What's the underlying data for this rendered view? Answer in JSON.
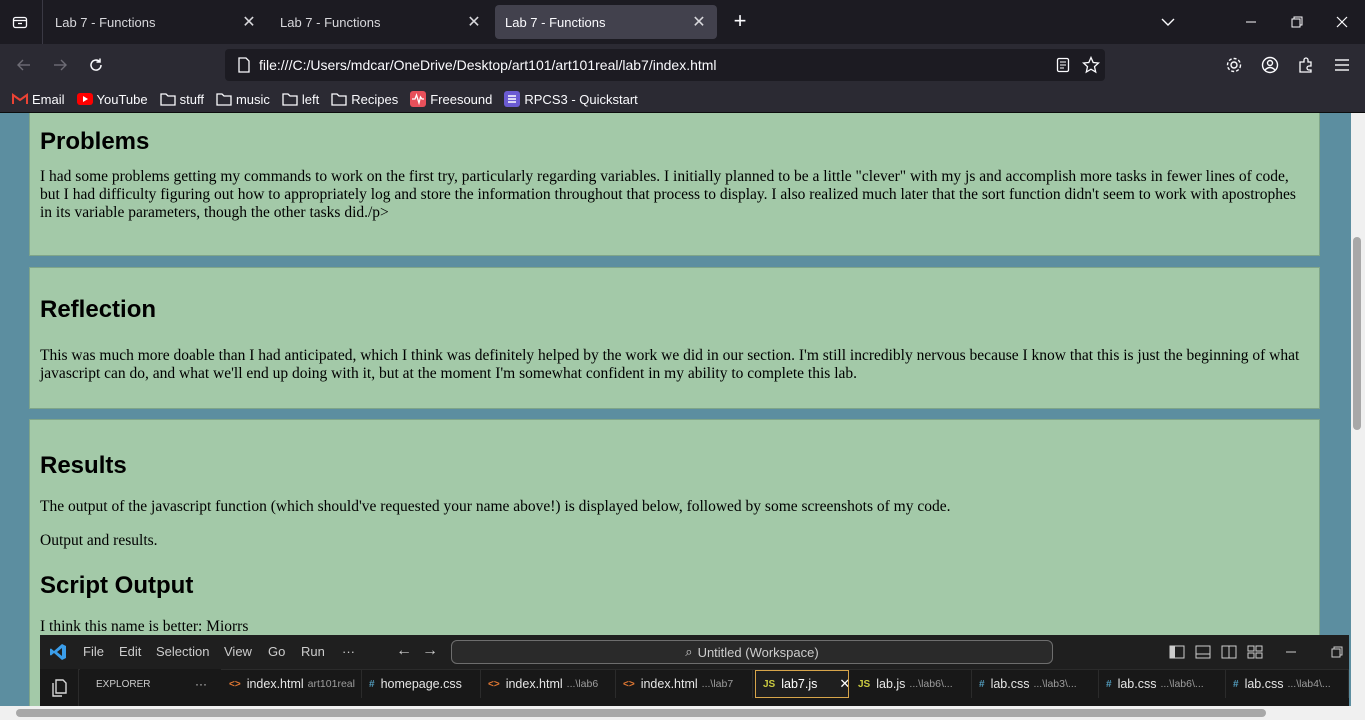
{
  "browser": {
    "tabs": [
      {
        "title": "Lab 7 - Functions",
        "active": false
      },
      {
        "title": "Lab 7 - Functions",
        "active": false
      },
      {
        "title": "Lab 7 - Functions",
        "active": true
      }
    ],
    "url": "file:///C:/Users/mdcar/OneDrive/Desktop/art101/art101real/lab7/index.html",
    "bookmarks": [
      {
        "label": "Email",
        "icon": "gmail-icon"
      },
      {
        "label": "YouTube",
        "icon": "youtube-icon"
      },
      {
        "label": "stuff",
        "icon": "folder-icon"
      },
      {
        "label": "music",
        "icon": "folder-icon"
      },
      {
        "label": "left",
        "icon": "folder-icon"
      },
      {
        "label": "Recipes",
        "icon": "folder-icon"
      },
      {
        "label": "Freesound",
        "icon": "freesound-icon"
      },
      {
        "label": "RPCS3 - Quickstart",
        "icon": "rpcs3-icon"
      }
    ],
    "colors": {
      "chrome_dark": "#1c1b22",
      "toolbar": "#2b2a33",
      "active_tab": "#42414d"
    }
  },
  "page": {
    "problems": {
      "heading": "Problems",
      "text": "I had some problems getting my commands to work on the first try, particularly regarding variables. I initially planned to be a little \"clever\" with my js and accomplish more tasks in fewer lines of code, but I had difficulty figuring out how to appropriately log and store the information throughout that process to display. I also realized much later that the sort function didn't seem to work with apostrophes in its variable parameters, though the other tasks did./p>"
    },
    "reflection": {
      "heading": "Reflection",
      "text": "This was much more doable than I had anticipated, which I think was definitely helped by the work we did in our section. I'm still incredibly nervous because I know that this is just the beginning of what javascript can do, and what we'll end up doing with it, but at the moment I'm somewhat confident in my ability to complete this lab."
    },
    "results": {
      "heading": "Results",
      "text": "The output of the javascript function (which should've requested your name above!) is displayed below, followed by some screenshots of my code.",
      "subtext": "Output and results.",
      "script_heading": "Script Output",
      "script_output": "I think this name is better: Miorrs"
    },
    "colors": {
      "background": "#5c8ea0",
      "section": "#a3c9a8"
    }
  },
  "vscode": {
    "menu": [
      "File",
      "Edit",
      "Selection",
      "View",
      "Go",
      "Run"
    ],
    "more": "···",
    "search": "Untitled (Workspace)",
    "explorer": "EXPLORER",
    "explorer_more": "···",
    "tabs": [
      {
        "icon": "<>",
        "name": "index.html",
        "dir": "art101real",
        "active": false
      },
      {
        "icon": "#",
        "name": "homepage.css",
        "dir": "",
        "active": false
      },
      {
        "icon": "<>",
        "name": "index.html",
        "dir": "...\\lab6",
        "active": false
      },
      {
        "icon": "<>",
        "name": "index.html",
        "dir": "...\\lab7",
        "active": false
      },
      {
        "icon": "JS",
        "name": "lab7.js",
        "dir": "",
        "active": true
      },
      {
        "icon": "JS",
        "name": "lab.js",
        "dir": "...\\lab6\\...",
        "active": false
      },
      {
        "icon": "#",
        "name": "lab.css",
        "dir": "...\\lab3\\...",
        "active": false
      },
      {
        "icon": "#",
        "name": "lab.css",
        "dir": "...\\lab6\\...",
        "active": false
      },
      {
        "icon": "#",
        "name": "lab.css",
        "dir": "...\\lab4\\...",
        "active": false
      }
    ]
  }
}
